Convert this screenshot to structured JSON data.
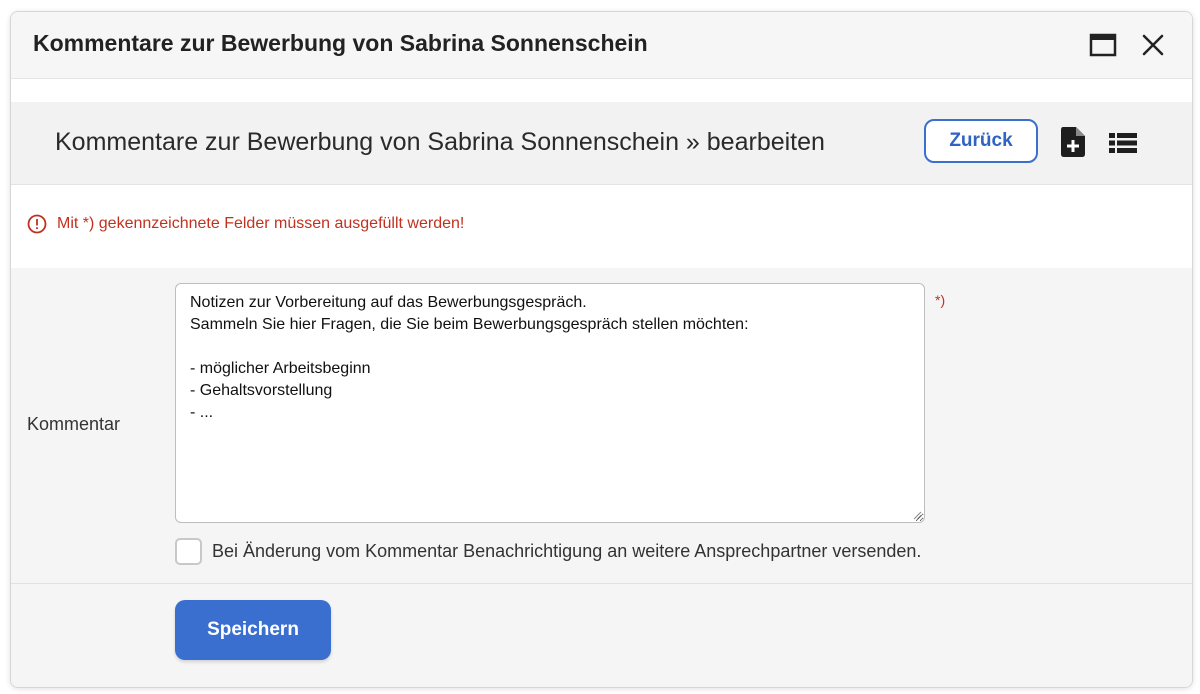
{
  "window": {
    "title": "Kommentare zur Bewerbung von Sabrina Sonnenschein",
    "maximize_icon": "window-maximize-icon",
    "close_icon": "close-icon"
  },
  "header": {
    "heading": "Kommentare zur Bewerbung von Sabrina Sonnenschein » bearbeiten",
    "back_label": "Zurück",
    "new_icon": "file-plus-icon",
    "list_icon": "list-icon"
  },
  "notice": {
    "text": "Mit *) gekennzeichnete Felder müssen ausgefüllt werden!",
    "icon": "exclamation-circle-icon"
  },
  "form": {
    "comment_label": "Kommentar",
    "comment_value": "Notizen zur Vorbereitung auf das Bewerbungsgespräch.\nSammeln Sie hier Fragen, die Sie beim Bewerbungsgespräch stellen möchten:\n\n- möglicher Arbeitsbeginn\n- Gehaltsvorstellung\n- ...",
    "required_mark": "*)",
    "notify_label": "Bei Änderung vom Kommentar Benachrichtigung an weitere Ansprechpartner versenden.",
    "notify_checked": false,
    "save_label": "Speichern"
  },
  "colors": {
    "accent": "#3a6fd0",
    "error": "#c0321f"
  }
}
